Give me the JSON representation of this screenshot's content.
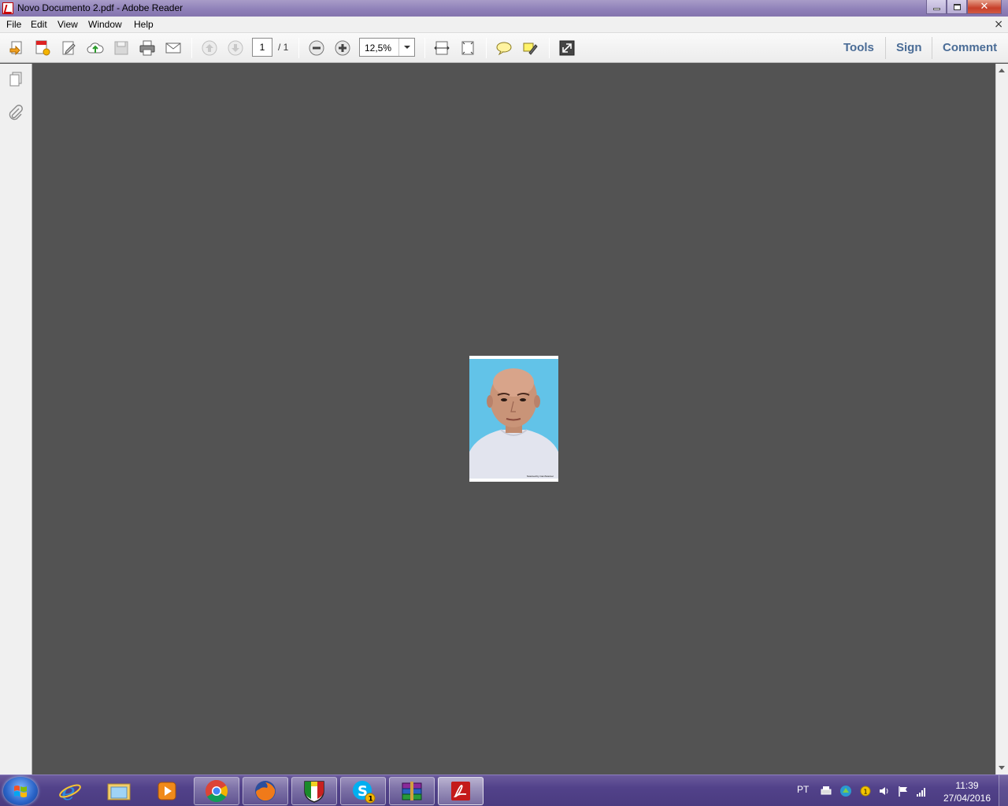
{
  "window": {
    "title": "Novo Documento 2.pdf - Adobe Reader",
    "close_glyph": "✕"
  },
  "menu": {
    "items": [
      "File",
      "Edit",
      "View",
      "Window",
      "Help"
    ],
    "doc_close": "×"
  },
  "toolbar": {
    "page_current": "1",
    "page_total": "/ 1",
    "zoom": "12,5%",
    "links": [
      "Tools",
      "Sign",
      "Comment"
    ],
    "icons": [
      "open-icon",
      "create-pdf-icon",
      "edit-icon",
      "cloud-upload-icon",
      "save-icon",
      "print-icon",
      "email-icon",
      "prev-page-icon",
      "next-page-icon",
      "zoom-out-icon",
      "zoom-in-icon",
      "fit-width-icon",
      "fit-page-icon",
      "sticky-note-icon",
      "highlight-icon",
      "full-screen-icon"
    ]
  },
  "navpane": {
    "icons": [
      "pages-icon",
      "attachments-icon"
    ]
  },
  "document": {
    "caption": "Scanned by CamScanner"
  },
  "taskbar": {
    "apps": [
      "internet-explorer",
      "windows-explorer",
      "media-player",
      "chrome",
      "firefox",
      "soccer-club-app",
      "skype",
      "winrar",
      "adobe-reader"
    ],
    "skype_badge": "1",
    "language": "PT",
    "time": "11:39",
    "date": "27/04/2016"
  },
  "colors": {
    "accent_link": "#4a6c96",
    "doc_background": "#535353",
    "taskbar": "#52428a",
    "photo_background": "#5ec0e6"
  }
}
